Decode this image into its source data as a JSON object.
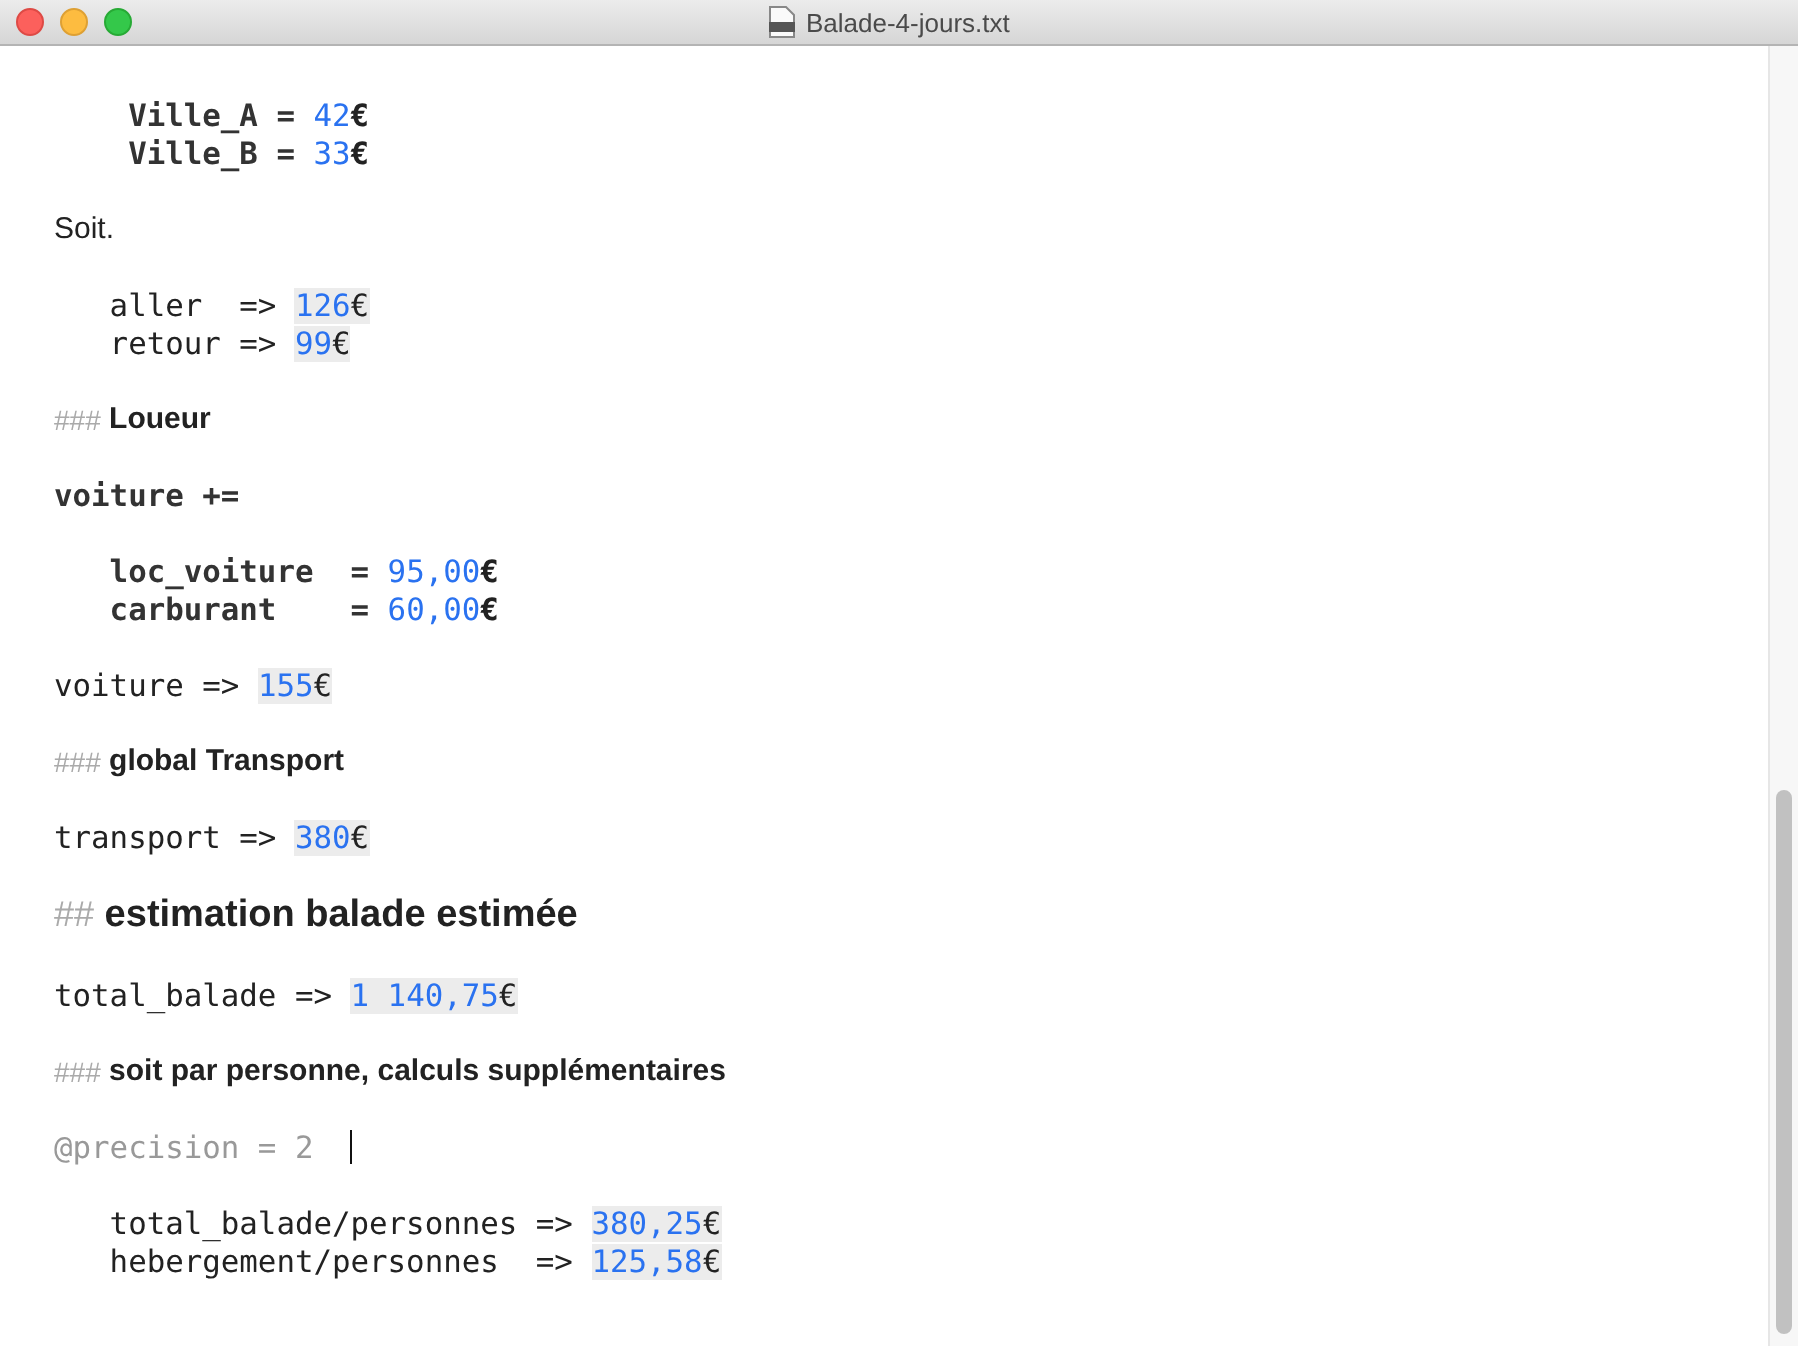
{
  "window": {
    "title": "Balade-4-jours.txt"
  },
  "lines": [
    {
      "kind": "blank"
    },
    {
      "kind": "blank"
    },
    {
      "kind": "code",
      "parts": [
        {
          "kind": "code",
          "text": "    Ville_A = ",
          "bold": true
        },
        {
          "kind": "value",
          "number": "42",
          "unit": "€",
          "highlighted": false
        }
      ]
    },
    {
      "kind": "code",
      "parts": [
        {
          "kind": "code",
          "text": "    Ville_B = ",
          "bold": true
        },
        {
          "kind": "value",
          "number": "33",
          "unit": "€",
          "highlighted": false
        }
      ]
    },
    {
      "kind": "blank"
    },
    {
      "kind": "text",
      "text": "Soit."
    },
    {
      "kind": "blank"
    },
    {
      "kind": "code",
      "parts": [
        {
          "kind": "code",
          "text": "   aller  => ",
          "bold": false
        },
        {
          "kind": "value",
          "number": "126",
          "unit": "€",
          "highlighted": true
        }
      ]
    },
    {
      "kind": "code",
      "parts": [
        {
          "kind": "code",
          "text": "   retour => ",
          "bold": false
        },
        {
          "kind": "value",
          "number": "99",
          "unit": "€",
          "highlighted": true
        }
      ]
    },
    {
      "kind": "blank"
    },
    {
      "kind": "heading3",
      "marker": "###",
      "text": "Loueur"
    },
    {
      "kind": "blank"
    },
    {
      "kind": "code",
      "parts": [
        {
          "kind": "code",
          "text": "voiture +=",
          "bold": true
        }
      ]
    },
    {
      "kind": "blank"
    },
    {
      "kind": "code",
      "parts": [
        {
          "kind": "code",
          "text": "   loc_voiture  = ",
          "bold": true
        },
        {
          "kind": "value",
          "number": "95,00",
          "unit": "€",
          "highlighted": false
        }
      ]
    },
    {
      "kind": "code",
      "parts": [
        {
          "kind": "code",
          "text": "   carburant    = ",
          "bold": true
        },
        {
          "kind": "value",
          "number": "60,00",
          "unit": "€",
          "highlighted": false
        }
      ]
    },
    {
      "kind": "blank"
    },
    {
      "kind": "code",
      "parts": [
        {
          "kind": "code",
          "text": "voiture => ",
          "bold": false
        },
        {
          "kind": "value",
          "number": "155",
          "unit": "€",
          "highlighted": true
        }
      ]
    },
    {
      "kind": "blank"
    },
    {
      "kind": "heading3",
      "marker": "###",
      "text": "global Transport"
    },
    {
      "kind": "blank"
    },
    {
      "kind": "code",
      "parts": [
        {
          "kind": "code",
          "text": "transport => ",
          "bold": false
        },
        {
          "kind": "value",
          "number": "380",
          "unit": "€",
          "highlighted": true
        }
      ]
    },
    {
      "kind": "blank"
    },
    {
      "kind": "heading2",
      "marker": "##",
      "text": "estimation balade estimée"
    },
    {
      "kind": "blank"
    },
    {
      "kind": "code",
      "parts": [
        {
          "kind": "code",
          "text": "total_balade => ",
          "bold": false
        },
        {
          "kind": "value",
          "number": "1 140,75",
          "unit": "€",
          "highlighted": true
        }
      ]
    },
    {
      "kind": "blank"
    },
    {
      "kind": "heading3",
      "marker": "###",
      "text": "soit par personne, calculs supplémentaires"
    },
    {
      "kind": "blank"
    },
    {
      "kind": "directive",
      "text": "@precision = 2",
      "cursor": true
    },
    {
      "kind": "blank"
    },
    {
      "kind": "code",
      "parts": [
        {
          "kind": "code",
          "text": "   total_balade/personnes => ",
          "bold": false
        },
        {
          "kind": "value",
          "number": "380,25",
          "unit": "€",
          "highlighted": true
        }
      ]
    },
    {
      "kind": "code",
      "parts": [
        {
          "kind": "code",
          "text": "   hebergement/personnes  => ",
          "bold": false
        },
        {
          "kind": "value",
          "number": "125,58",
          "unit": "€",
          "highlighted": true
        }
      ]
    }
  ]
}
